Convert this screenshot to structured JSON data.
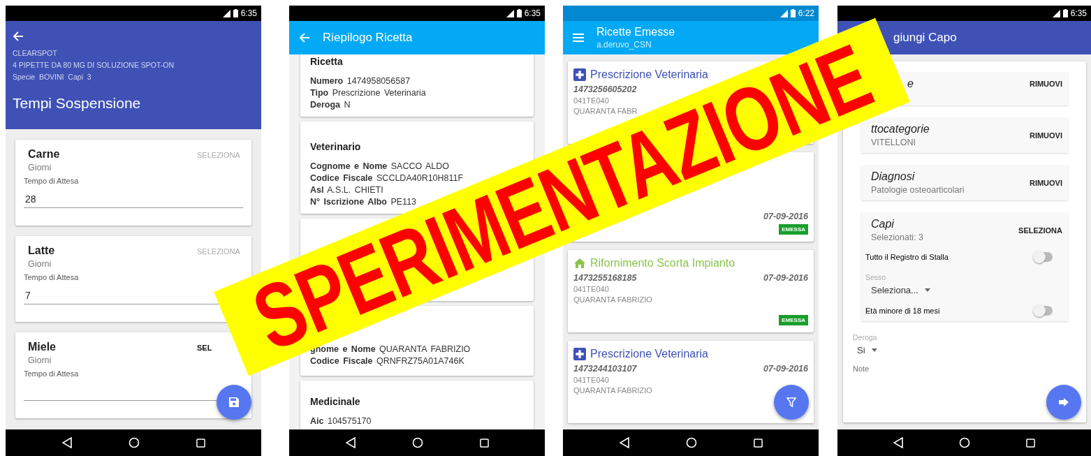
{
  "screens": [
    {
      "kind": "tempi",
      "time": "6:35",
      "header": {
        "lines": [
          "CLEARSPOT",
          "4 PIPETTE DA 80 MG DI SOLUZIONE SPOT-ON",
          "Specie  BOVINI  Capi  3"
        ],
        "title": "Tempi Sospensione"
      },
      "cards": [
        {
          "title": "Carne",
          "unit": "Giorni",
          "action": "SELEZIONA",
          "enabled": false,
          "label": "Tempo di Attesa",
          "value": "28"
        },
        {
          "title": "Latte",
          "unit": "Giorni",
          "action": "SELEZIONA",
          "enabled": false,
          "label": "Tempo di Attesa",
          "value": "7"
        },
        {
          "title": "Miele",
          "unit": "Giorni",
          "action": "SEL",
          "enabled": true,
          "label": "Tempo di Attesa"
        }
      ]
    },
    {
      "kind": "riepilogo",
      "time": "6:35",
      "header": {
        "title": "Riepilogo Ricetta"
      },
      "cards": [
        {
          "title": "Ricetta",
          "rows": [
            "**Numero** 1474958056587",
            "**Tipo** Prescrizione Veterinaria",
            "**Deroga** N"
          ]
        },
        {
          "title": "Veterinario",
          "rows": [
            "**Cognome e Nome** SACCO ALDO",
            "**Codice Fiscale** SCCLDA40R10H811F",
            "**Asl** A.S.L. CHIETI",
            "**N° Iscrizione Albo** PE113"
          ]
        },
        {
          "rows": [
            "**gnome e Nome** QUARANTA FABRIZIO",
            "**Codice Fiscale** QRNFRZ75A01A746K"
          ]
        },
        {
          "title": "Medicinale",
          "rows": [
            "**Aic** 104575170"
          ]
        }
      ]
    },
    {
      "kind": "ricette",
      "time": "6:22",
      "header": {
        "title": "Ricette Emesse",
        "subtitle": "a.deruvo_CSN"
      },
      "items": [
        {
          "kind": "prescrizione",
          "title": "Prescrizione Veterinaria",
          "number": "1473256605202",
          "code": "041TE040",
          "name": "QUARANTA FABR"
        },
        {
          "kind": "prescrizione",
          "date": "07-09-2016",
          "status": "EMESSA"
        },
        {
          "kind": "rifornimento",
          "title": "Rifornimento Scorta Impianto",
          "number": "1473255168185",
          "date": "07-09-2016",
          "code": "041TE040",
          "name": "QUARANTA FABRIZIO",
          "status": "EMESSA"
        },
        {
          "kind": "prescrizione",
          "title": "Prescrizione Veterinaria",
          "number": "1473244103107",
          "date": "07-09-2016",
          "code": "041TE040",
          "name": "QUARANTA FABRIZIO"
        }
      ]
    },
    {
      "kind": "capo",
      "time": "6:35",
      "header": {
        "title": "giungi Capo"
      },
      "sections": [
        {
          "title": "e",
          "action": "RIMUOVI"
        },
        {
          "title": "ttocategorie",
          "subtitle": "VITELLONI",
          "action": "RIMUOVI"
        },
        {
          "title": "Diagnosi",
          "subtitle": "Patologie osteoarticolari",
          "action": "RIMUOVI"
        },
        {
          "title": "Capi",
          "subtitle": "Selezionati: 3",
          "action": "SELEZIONA",
          "rows": [
            {
              "kind": "toggle",
              "label": "Tutto il Registro di Stalla",
              "on": false
            },
            {
              "kind": "select",
              "label": "Sesso",
              "value": "Seleziona..."
            },
            {
              "kind": "toggle",
              "label": "Età minore di 18 mesi",
              "on": false
            }
          ]
        }
      ],
      "deroga": {
        "label": "Deroga",
        "value": "Si"
      },
      "note": {
        "placeholder": "Note"
      }
    }
  ],
  "banner": "SPERIMENTAZIONE"
}
